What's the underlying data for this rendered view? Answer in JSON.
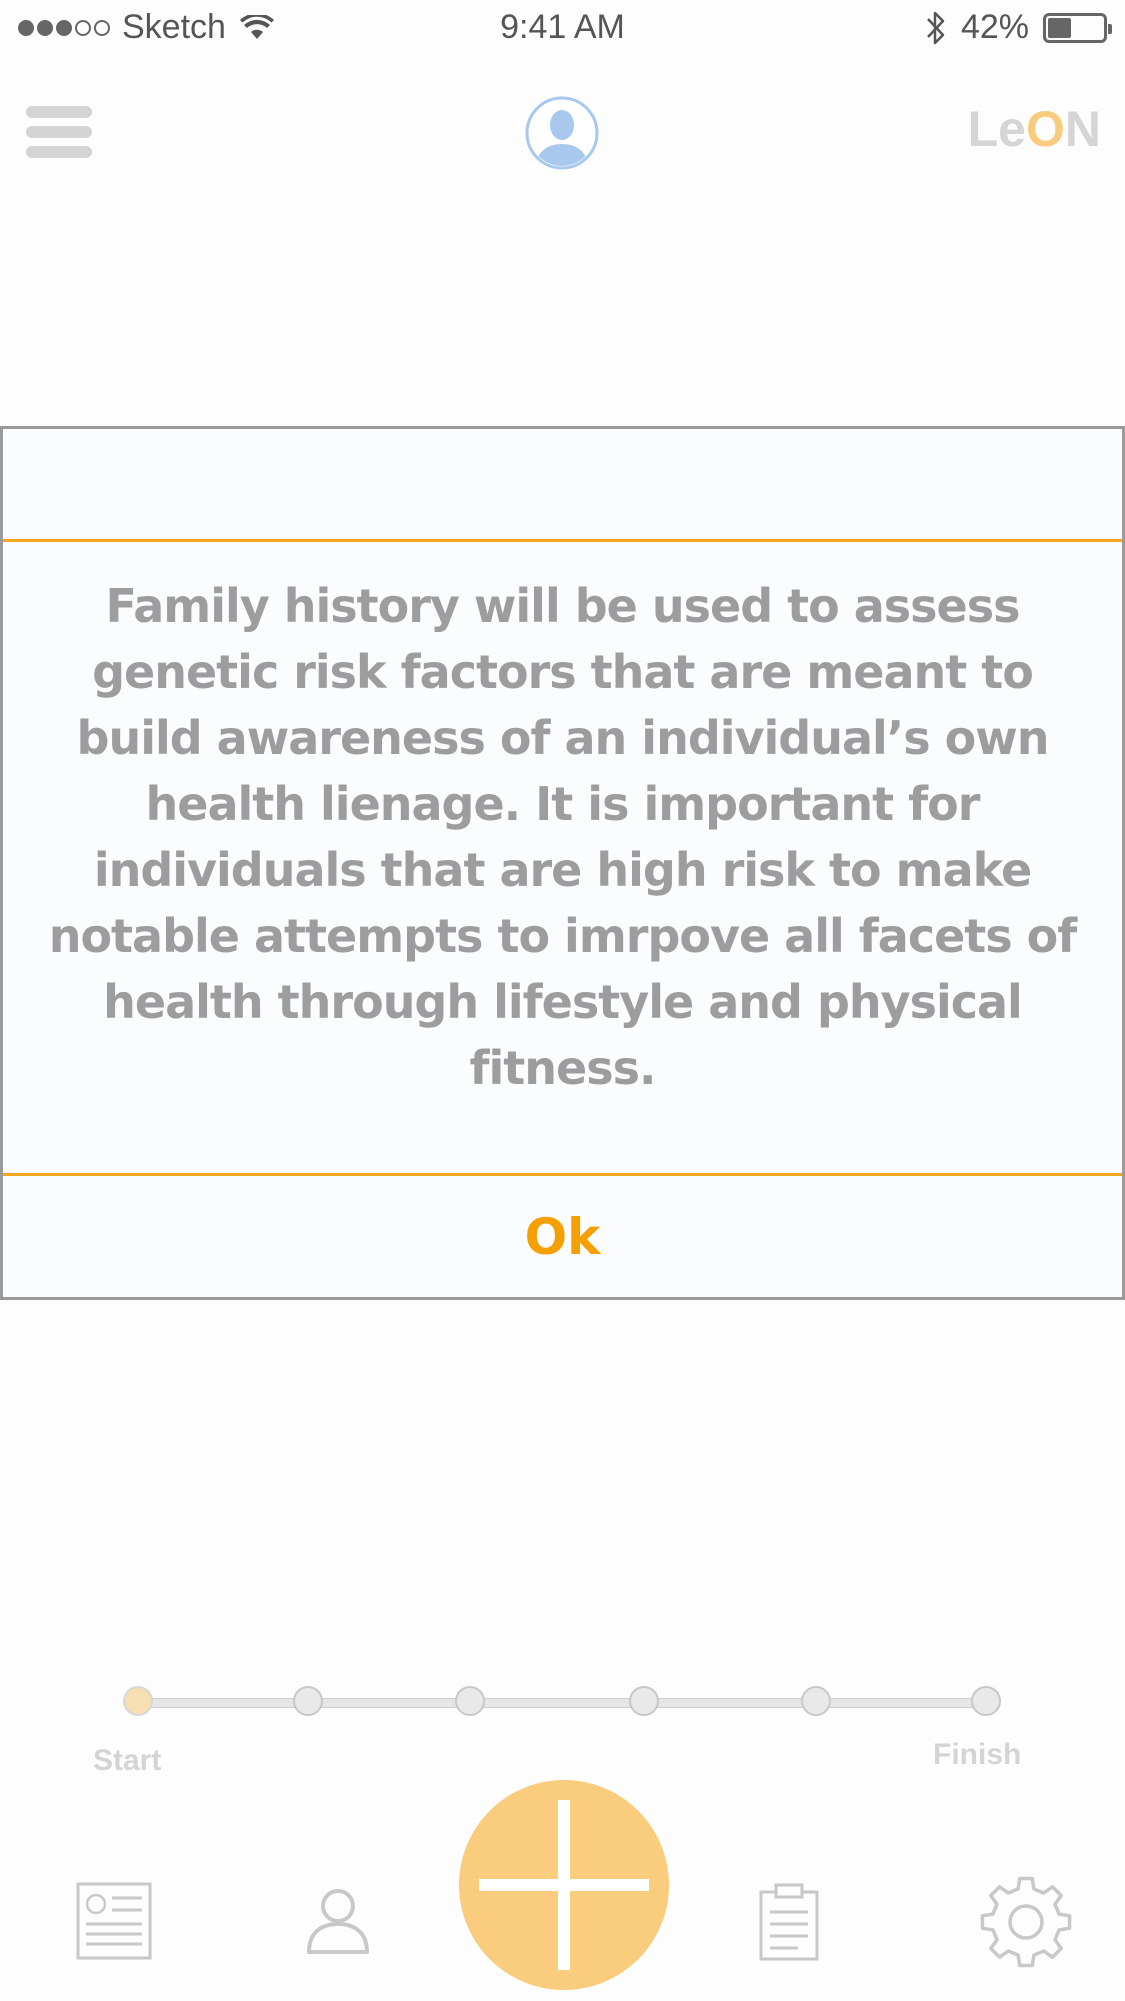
{
  "status_bar": {
    "signal_bars_filled": 3,
    "signal_bars_total": 5,
    "carrier": "Sketch",
    "time": "9:41 AM",
    "battery_percent": "42%",
    "battery_level": 0.42
  },
  "header": {
    "logo_prefix": "Le",
    "logo_accent": "O",
    "logo_suffix": "N"
  },
  "modal": {
    "message": "Family history will be used to assess genetic risk factors that are meant to build awareness of an individual’s own health lienage. It is important for individuals that are high risk to make notable attempts to imrpove all facets of health through lifestyle and physical fitness.",
    "ok_label": "Ok"
  },
  "progress": {
    "start_label": "Start",
    "finish_label": "Finish",
    "steps_total": 6,
    "current_step": 1
  },
  "tab_bar": {
    "items": [
      {
        "icon": "news-icon"
      },
      {
        "icon": "profile-icon"
      },
      {
        "icon": "add-icon"
      },
      {
        "icon": "clipboard-icon"
      },
      {
        "icon": "gear-icon"
      }
    ]
  },
  "colors": {
    "accent": "#f5a623",
    "fab": "#f9cc7e",
    "text_gray": "#9d9d9d",
    "logo_gray": "#d5d5d5",
    "avatar_blue": "#a9c8ee"
  }
}
